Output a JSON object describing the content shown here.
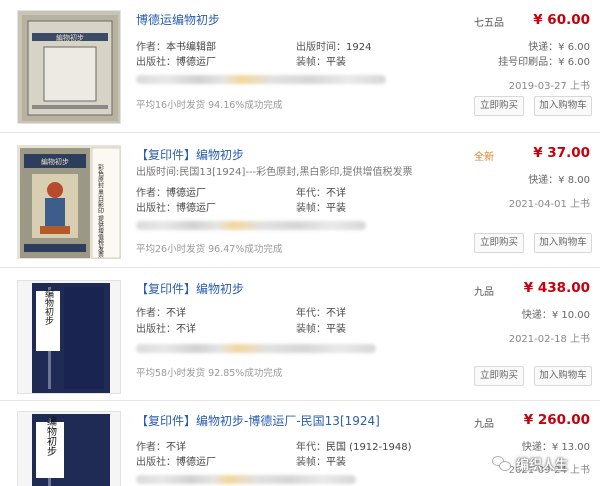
{
  "listings": [
    {
      "title": "博德运编物初步",
      "tag": "",
      "subline": "",
      "condition": "七五品",
      "price": "¥ 60.00",
      "fields": [
        {
          "k": "作者：",
          "v": "本书编辑部"
        },
        {
          "k": "出版时间：",
          "v": "1924"
        },
        {
          "k": "出版社：",
          "v": "博德运厂"
        },
        {
          "k": "装帧：",
          "v": "平装"
        }
      ],
      "shipping": [
        "快递：¥ 6.00",
        "挂号印刷品：¥ 6.00"
      ],
      "date": "2019-03-27 上书",
      "stats": "平均16小时发货    94.16%成功完成",
      "buy": "立即购买",
      "cart": "加入购物车"
    },
    {
      "title": "编物初步",
      "tag": "【复印件】",
      "subline": "出版时间:民国13[1924]---彩色原封,黑白影印,提供增值税发票",
      "condition": "全新",
      "price": "¥ 37.00",
      "fields": [
        {
          "k": "作者：",
          "v": "博德运厂"
        },
        {
          "k": "年代：",
          "v": "不详"
        },
        {
          "k": "出版社：",
          "v": "博德运厂"
        },
        {
          "k": "装帧：",
          "v": "平装"
        }
      ],
      "shipping": [
        "快递：¥ 8.00"
      ],
      "date": "2021-04-01 上书",
      "stats": "平均26小时发货    96.47%成功完成",
      "buy": "立即购买",
      "cart": "加入购物车"
    },
    {
      "title": "编物初步",
      "tag": "【复印件】",
      "subline": "",
      "condition": "九品",
      "price": "¥ 438.00",
      "fields": [
        {
          "k": "作者：",
          "v": "不详"
        },
        {
          "k": "年代：",
          "v": "不详"
        },
        {
          "k": "出版社：",
          "v": "不详"
        },
        {
          "k": "装帧：",
          "v": "平装"
        }
      ],
      "shipping": [
        "快递：¥ 10.00"
      ],
      "date": "2021-02-18 上书",
      "stats": "平均58小时发货    92.85%成功完成",
      "buy": "立即购买",
      "cart": "加入购物车"
    },
    {
      "title": "编物初步-博德运厂-民国13[1924]",
      "tag": "【复印件】",
      "subline": "",
      "condition": "九品",
      "price": "¥ 260.00",
      "fields": [
        {
          "k": "作者：",
          "v": "不详"
        },
        {
          "k": "年代：",
          "v": "民国 (1912-1948)"
        },
        {
          "k": "出版社：",
          "v": "博德运厂"
        },
        {
          "k": "装帧：",
          "v": "平装"
        }
      ],
      "shipping": [
        "快递：¥ 13.00"
      ],
      "date": "2021-09-24 上书",
      "stats": "",
      "buy": "",
      "cart": ""
    }
  ],
  "covers": [
    {
      "title_text": "編物初步"
    },
    {
      "title_text": "編物初步",
      "side_text": "彩色原封 黑白影印 提供增值税发票"
    },
    {
      "title_text": "编物初步"
    },
    {
      "title_text": "编物初步"
    }
  ],
  "watermark": {
    "text": "编织人生",
    "icon": "wechat-icon"
  },
  "colors": {
    "price": "#c7000b",
    "link": "#2a5db0",
    "new_condition": "#d9822b"
  }
}
